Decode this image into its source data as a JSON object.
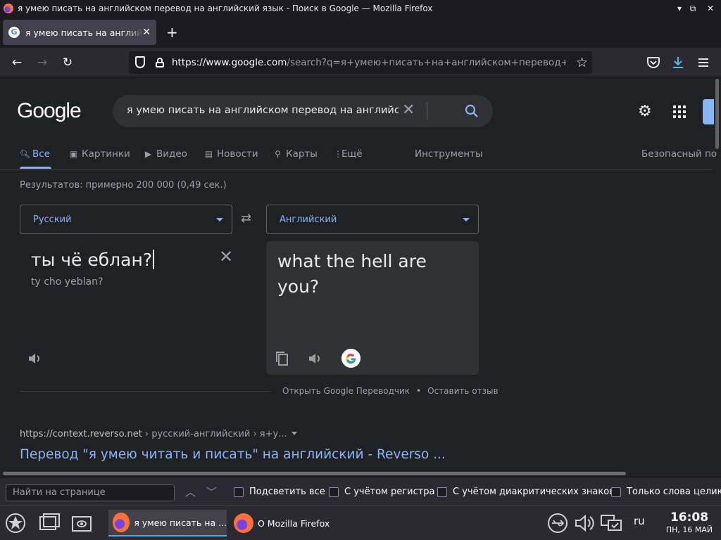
{
  "window": {
    "title": "я умею писать на английском перевод на английский язык - Поиск в Google — Mozilla Firefox"
  },
  "tab": {
    "label": "я умею писать на английском",
    "favicon": "G"
  },
  "urlbar": {
    "host": "https://www.google.com",
    "path": "/search?q=я+умею+писать+на+английском+перевод+на+а"
  },
  "search": {
    "logo": "Google",
    "query": "я умею писать на английском перевод на английский"
  },
  "tabs": {
    "all": "Все",
    "images": "Картинки",
    "video": "Видео",
    "news": "Новости",
    "maps": "Карты",
    "more": "Ещё",
    "tools": "Инструменты",
    "safesearch": "Безопасный по"
  },
  "stats": "Результатов: примерно 200 000 (0,49 сек.)",
  "translator": {
    "source_lang": "Русский",
    "target_lang": "Английский",
    "source_text": "ты чё еблан?",
    "transliteration": "ty cho yeblan?",
    "target_text": "what the hell are you?",
    "open_link": "Открыть Google Переводчик",
    "feedback_link": "Оставить отзыв"
  },
  "result": {
    "url": "https://context.reverso.net",
    "crumbs": " › русский-английский › я+у...",
    "title": "Перевод \"я умею читать и писать\" на английский - Reverso ..."
  },
  "findbar": {
    "placeholder": "Найти на странице",
    "highlight_all": "Подсветить все",
    "match_case": "С учётом регистра",
    "diacritics": "С учётом диакритических знаков",
    "whole_words": "Только слова целико"
  },
  "taskbar": {
    "task1": "я умею писать на ...",
    "task2": "О Mozilla Firefox",
    "lang": "ru",
    "time": "16:08",
    "date": "ПН, 16 МАЙ"
  },
  "colors": {
    "accent_link": "#8ab4f8",
    "page_bg": "#202124",
    "chrome_bg": "#2b2a33"
  }
}
